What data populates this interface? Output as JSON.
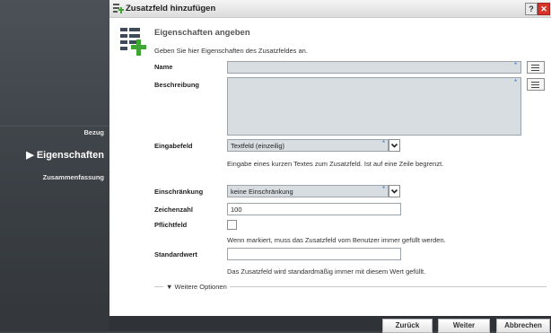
{
  "sidebar": {
    "items": [
      {
        "label": "Bezug",
        "active": false
      },
      {
        "label": "▶ Eigenschaften",
        "active": true
      },
      {
        "label": "Zusammenfassung",
        "active": false
      }
    ]
  },
  "dialog": {
    "title": "Zusatzfeld hinzufügen",
    "help_label": "?",
    "close_label": "✕",
    "header": {
      "heading": "Eigenschaften angeben",
      "subheading": "Geben Sie hier Eigenschaften des Zusatzfeldes an."
    },
    "fields": {
      "name": {
        "label": "Name",
        "value": ""
      },
      "beschreibung": {
        "label": "Beschreibung",
        "value": ""
      },
      "eingabefeld": {
        "label": "Eingabefeld",
        "value": "Textfeld (einzeilig)",
        "hint": "Eingabe eines kurzen Textes zum Zusatzfeld. Ist auf eine Zeile begrenzt."
      },
      "einschraenkung": {
        "label": "Einschränkung",
        "value": "keine Einschränkung"
      },
      "zeichenzahl": {
        "label": "Zeichenzahl",
        "value": "100"
      },
      "pflichtfeld": {
        "label": "Pflichtfeld",
        "checked": false,
        "hint": "Wenn markiert, muss das Zusatzfeld vom Benutzer immer gefüllt werden."
      },
      "standardwert": {
        "label": "Standardwert",
        "value": "",
        "hint": "Das Zusatzfeld wird standardmäßig immer mit diesem Wert gefüllt."
      }
    },
    "required_marker": "*",
    "more_options": "▼ Weitere Optionen",
    "buttons": {
      "back": "Zurück",
      "next": "Weiter",
      "cancel": "Abbrechen"
    }
  },
  "colors": {
    "required": "#3d6fc9",
    "close": "#d9342b",
    "field_bg": "#d8dde1",
    "icon_green": "#3fa535"
  }
}
